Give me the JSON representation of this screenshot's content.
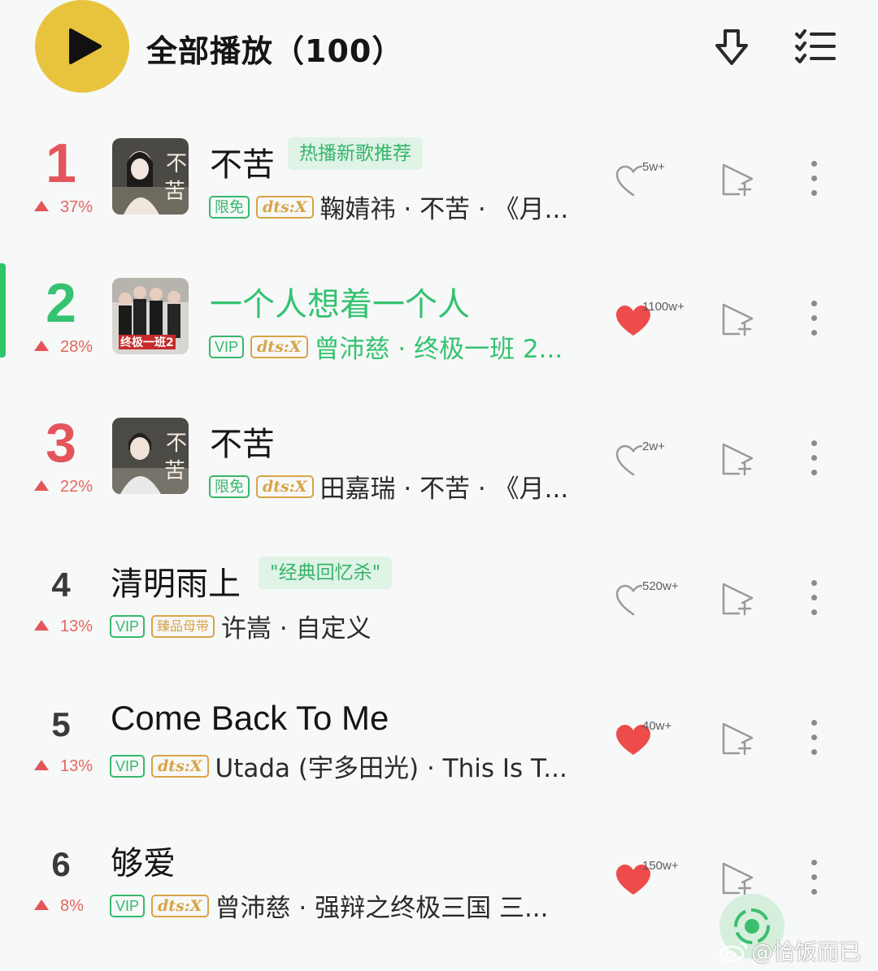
{
  "header": {
    "title": "全部播放（100）",
    "play_icon": "play-icon",
    "download_icon": "download-icon",
    "multiselect_icon": "multiselect-icon"
  },
  "colors": {
    "accent_green": "#35c271",
    "play_button": "#e8c43e",
    "rank_red": "#e4555b",
    "heart_red": "#ee4b4b"
  },
  "songs": [
    {
      "rank": "1",
      "trend": "37%",
      "title": "不苦",
      "tag": "热播新歌推荐",
      "badges": [
        "限免",
        "dts:X"
      ],
      "artist_line": "鞠婧祎 · 不苦 · 《月...",
      "likes": "5w+",
      "liked": false,
      "cover_text": "不苦"
    },
    {
      "rank": "2",
      "trend": "28%",
      "title": "一个人想着一个人",
      "tag": "",
      "badges": [
        "VIP",
        "dts:X"
      ],
      "artist_line": "曾沛慈 · 终极一班 2...",
      "likes": "1100w+",
      "liked": true,
      "playing": true,
      "cover_text": "终极一班2"
    },
    {
      "rank": "3",
      "trend": "22%",
      "title": "不苦",
      "tag": "",
      "badges": [
        "限免",
        "dts:X"
      ],
      "artist_line": "田嘉瑞 · 不苦 · 《月...",
      "likes": "2w+",
      "liked": false,
      "cover_text": "不苦"
    },
    {
      "rank": "4",
      "trend": "13%",
      "title": "清明雨上",
      "tag": "\"经典回忆杀\"",
      "badges": [
        "VIP",
        "臻品母带"
      ],
      "artist_line": "许嵩 · 自定义",
      "likes": "520w+",
      "liked": false
    },
    {
      "rank": "5",
      "trend": "13%",
      "title": "Come Back To Me",
      "tag": "",
      "badges": [
        "VIP",
        "dts:X"
      ],
      "artist_line": "Utada (宇多田光) · This Is T...",
      "likes": "40w+",
      "liked": true
    },
    {
      "rank": "6",
      "trend": "8%",
      "title": "够爱",
      "tag": "",
      "badges": [
        "VIP",
        "dts:X"
      ],
      "artist_line": "曾沛慈 · 强辩之终极三国 三...",
      "likes": "150w+",
      "liked": true
    }
  ],
  "watermark": "@恰饭而已"
}
